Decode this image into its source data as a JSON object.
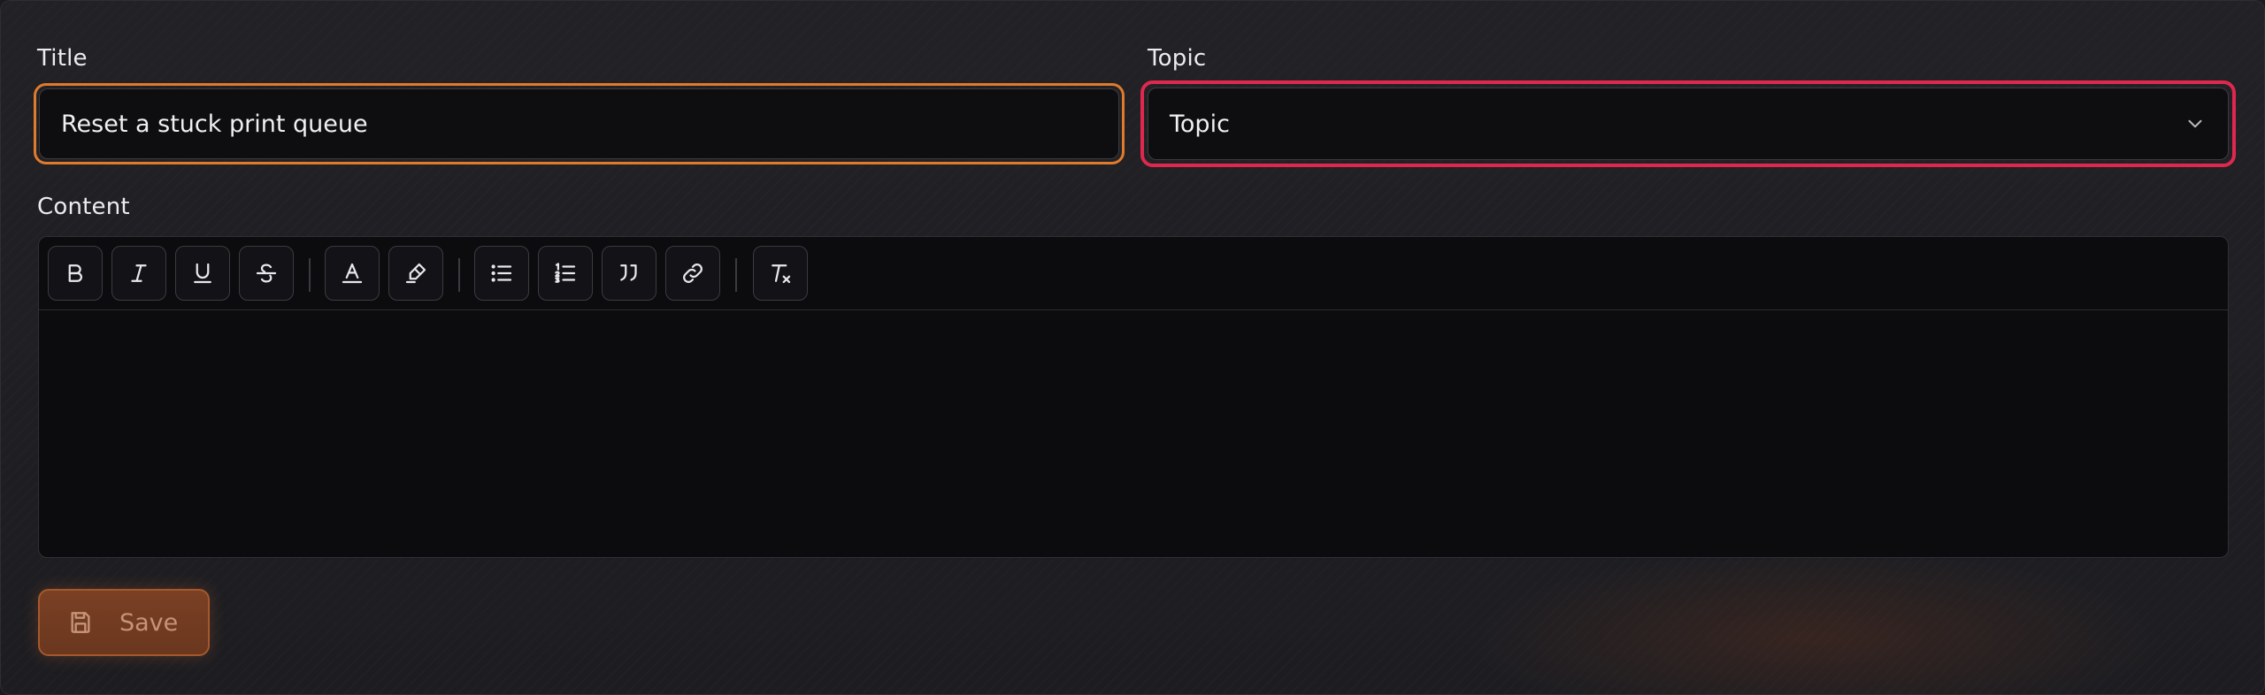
{
  "form": {
    "title_label": "Title",
    "title_value": "Reset a stuck print queue",
    "topic_label": "Topic",
    "topic_value": "Topic",
    "content_label": "Content",
    "content_value": ""
  },
  "toolbar": {
    "groups": [
      [
        "bold-icon",
        "italic-icon",
        "underline-icon",
        "strikethrough-icon"
      ],
      [
        "text-color-icon",
        "highlight-icon"
      ],
      [
        "bullet-list-icon",
        "ordered-list-icon",
        "blockquote-icon",
        "link-icon"
      ],
      [
        "clear-format-icon"
      ]
    ]
  },
  "save_button": {
    "label": "Save",
    "icon": "save-icon"
  },
  "colors": {
    "title_focus_ring": "#e07a2c",
    "topic_error_ring": "#e0284f",
    "save_button_bg": "#6a371f"
  }
}
